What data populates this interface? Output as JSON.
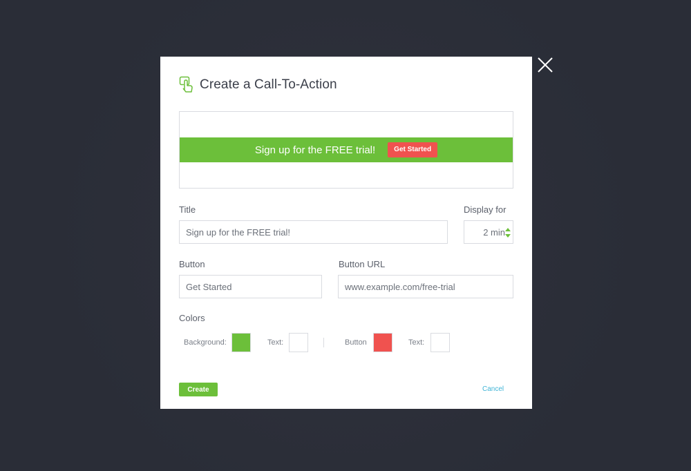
{
  "dialog": {
    "title": "Create a Call-To-Action",
    "icon": "hand-pointer-icon"
  },
  "preview": {
    "text": "Sign up for the FREE trial!",
    "button_label": "Get Started",
    "bar_color": "#6cbf3a",
    "button_color": "#f0524f"
  },
  "form": {
    "title_label": "Title",
    "title_value": "Sign up for the FREE trial!",
    "display_label": "Display for",
    "display_value": "2 min",
    "button_label": "Button",
    "button_value": "Get Started",
    "button_url_label": "Button URL",
    "button_url_value": "www.example.com/free-trial"
  },
  "colors": {
    "section_label": "Colors",
    "background_label": "Background:",
    "background_color": "#6cbf3a",
    "text_label": "Text:",
    "text_color": "#ffffff",
    "button_label": "Button",
    "button_color": "#f0524f",
    "button_text_label": "Text:",
    "button_text_color": "#ffffff"
  },
  "actions": {
    "create_label": "Create",
    "cancel_label": "Cancel"
  }
}
